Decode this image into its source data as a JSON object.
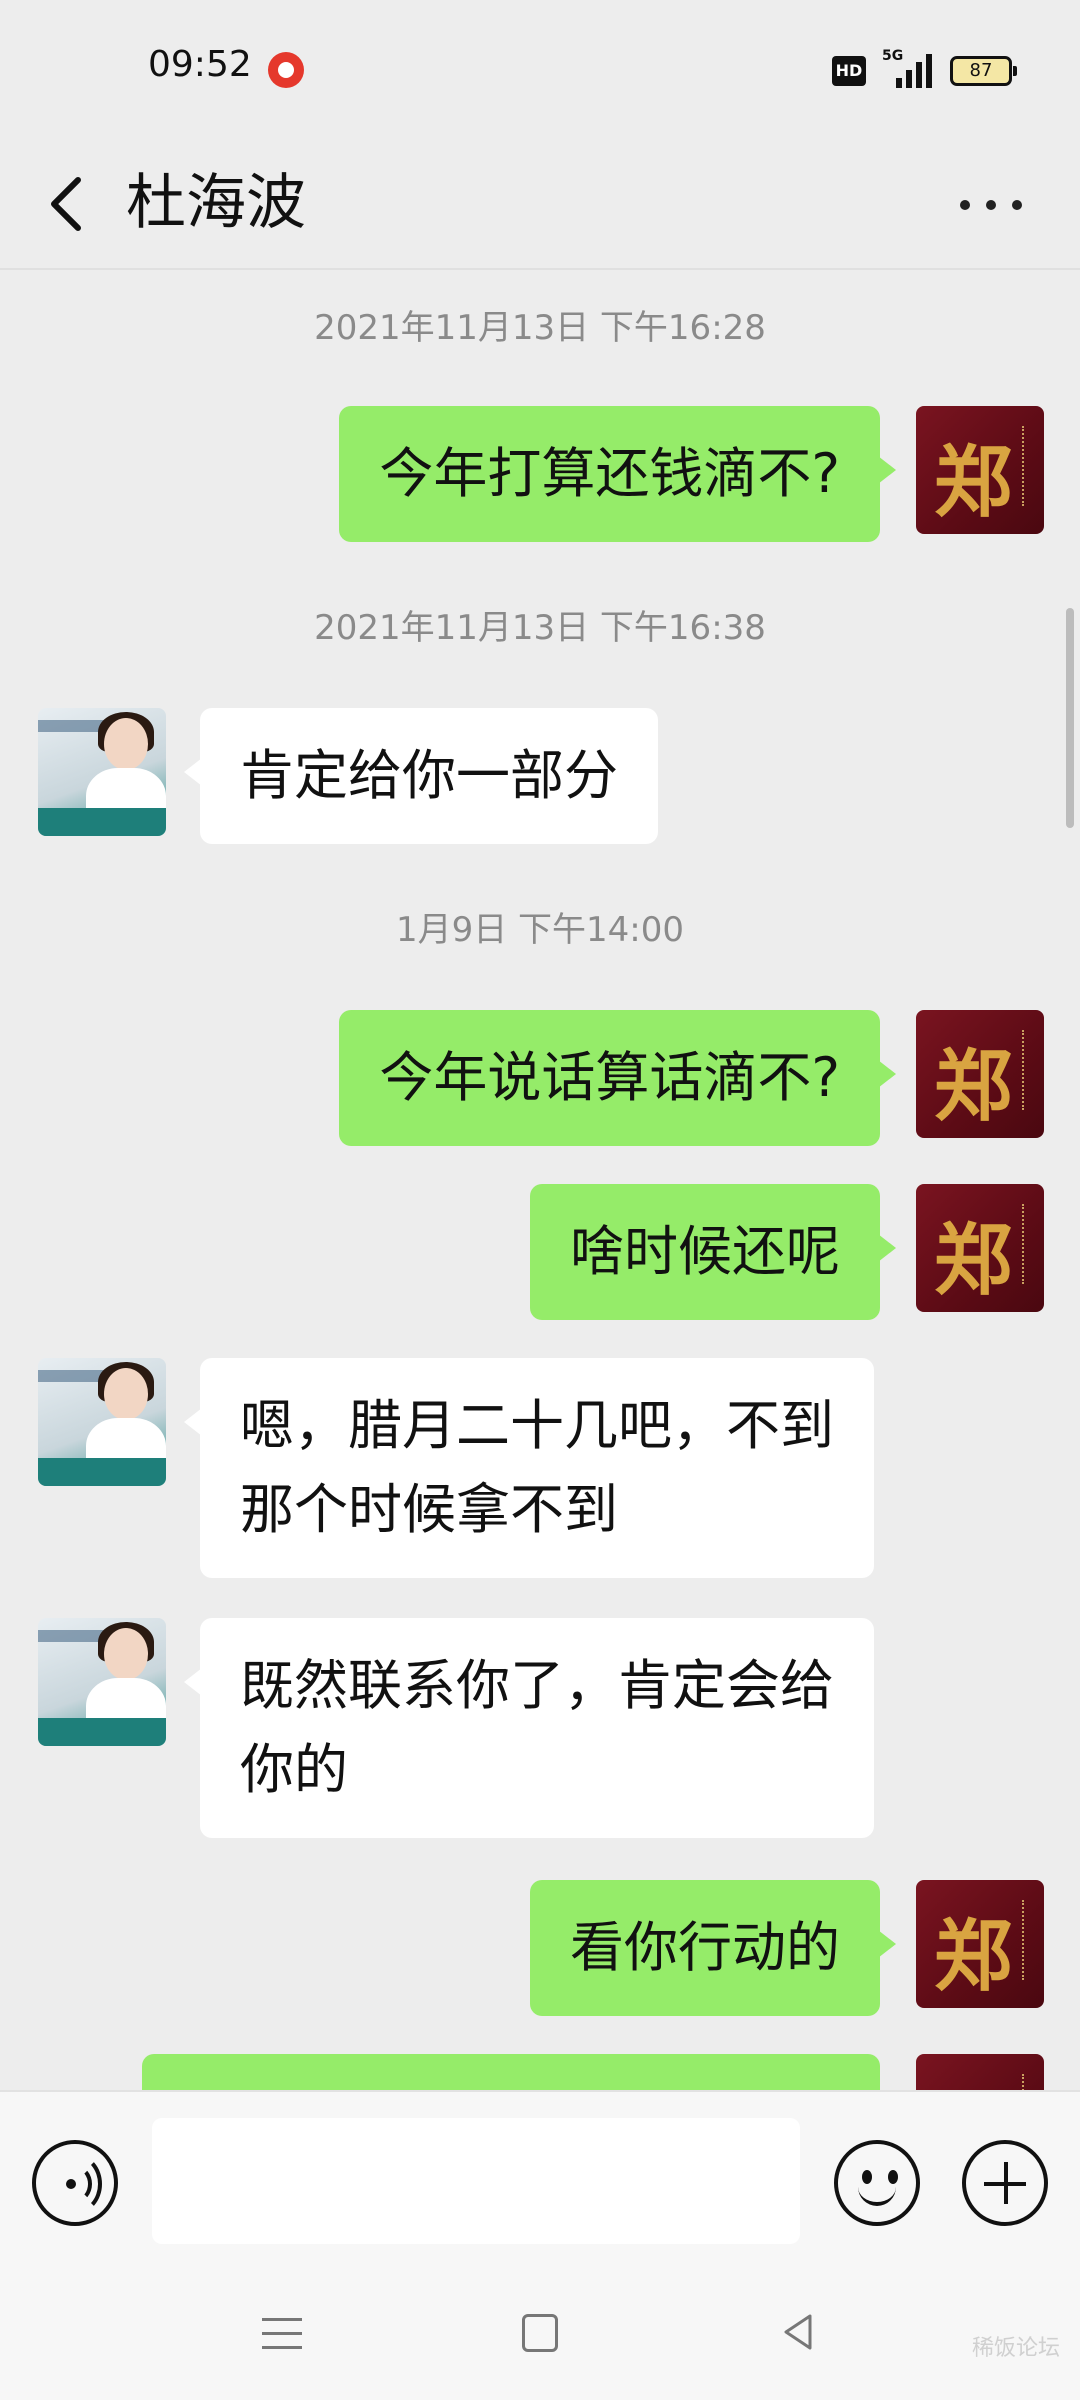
{
  "status_bar": {
    "time": "09:52",
    "battery": "87",
    "hd_label": "HD",
    "network": "5G"
  },
  "header": {
    "contact_name": "杜海波"
  },
  "messages": [
    {
      "kind": "time",
      "text": "2021年11月13日 下午16:28"
    },
    {
      "kind": "me",
      "text": "今年打算还钱滴不?"
    },
    {
      "kind": "time",
      "text": "2021年11月13日 下午16:38"
    },
    {
      "kind": "other",
      "text": "肯定给你一部分"
    },
    {
      "kind": "time",
      "text": "1月9日 下午14:00"
    },
    {
      "kind": "me",
      "text": "今年说话算话滴不?"
    },
    {
      "kind": "me",
      "text": "啥时候还呢"
    },
    {
      "kind": "other",
      "line1": "嗯，腊月二十几吧，不到",
      "line2": "那个时候拿不到"
    },
    {
      "kind": "other",
      "line1": "既然联系你了，肯定会给",
      "line2": "你的"
    },
    {
      "kind": "me",
      "text": "看你行动的"
    }
  ],
  "avatar_me_glyph": "郑",
  "colors": {
    "bubble_me": "#95ec69",
    "bubble_other": "#ffffff",
    "background": "#ededed"
  },
  "input": {
    "value": ""
  },
  "watermark": "稀饭论坛"
}
